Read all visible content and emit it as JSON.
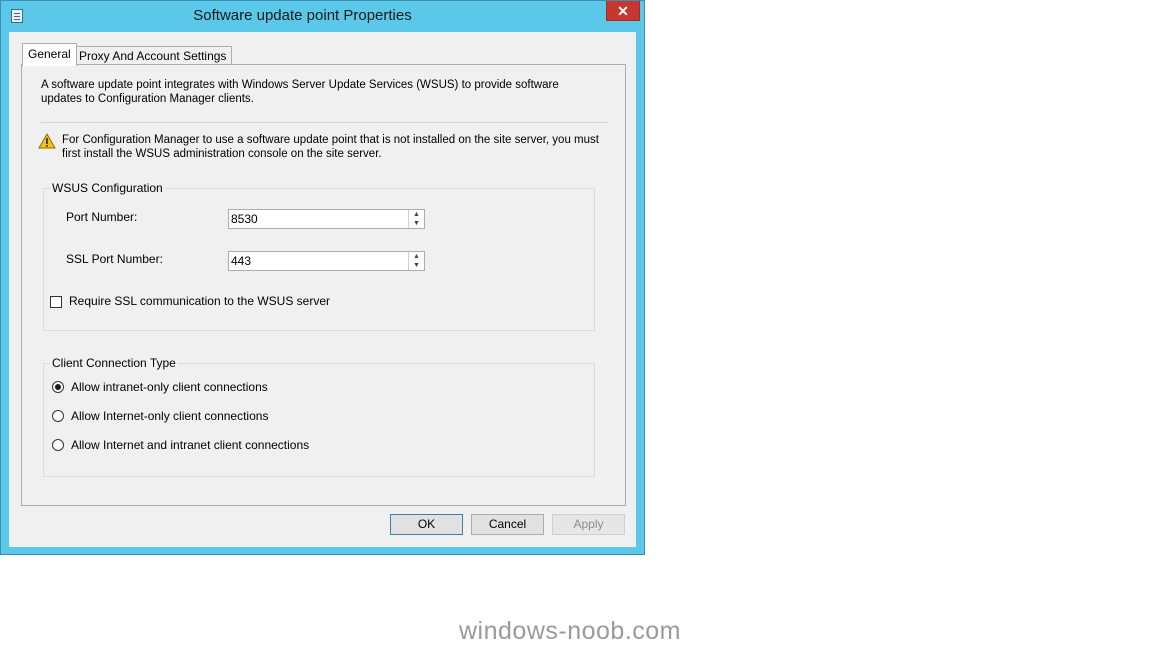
{
  "window": {
    "title": "Software update point Properties",
    "close_label": "✕"
  },
  "tabs": [
    {
      "label": "General",
      "active": true
    },
    {
      "label": "Proxy And Account Settings",
      "active": false
    }
  ],
  "general": {
    "intro": "A software update point integrates with Windows Server Update Services (WSUS) to provide software updates to Configuration Manager clients.",
    "warning": "For Configuration Manager to use a software update point that is not installed on the site server, you must first install the WSUS administration console on the site server.",
    "wsus_group": {
      "label": "WSUS Configuration",
      "port_label": "Port Number:",
      "port_value": "8530",
      "ssl_port_label": "SSL Port Number:",
      "ssl_port_value": "443",
      "require_ssl_label": "Require SSL communication to the WSUS server",
      "require_ssl_checked": false
    },
    "client_group": {
      "label": "Client Connection Type",
      "options": [
        {
          "label": "Allow intranet-only client connections",
          "selected": true
        },
        {
          "label": "Allow Internet-only client connections",
          "selected": false
        },
        {
          "label": "Allow Internet and intranet client connections",
          "selected": false
        }
      ]
    }
  },
  "buttons": {
    "ok": "OK",
    "cancel": "Cancel",
    "apply": "Apply"
  },
  "watermark": "windows-noob.com",
  "colors": {
    "title_bar": "#5bc8ea",
    "close_button": "#c7372f",
    "dialog_background": "#f0f0f0",
    "warning_icon": "#f2c318"
  }
}
